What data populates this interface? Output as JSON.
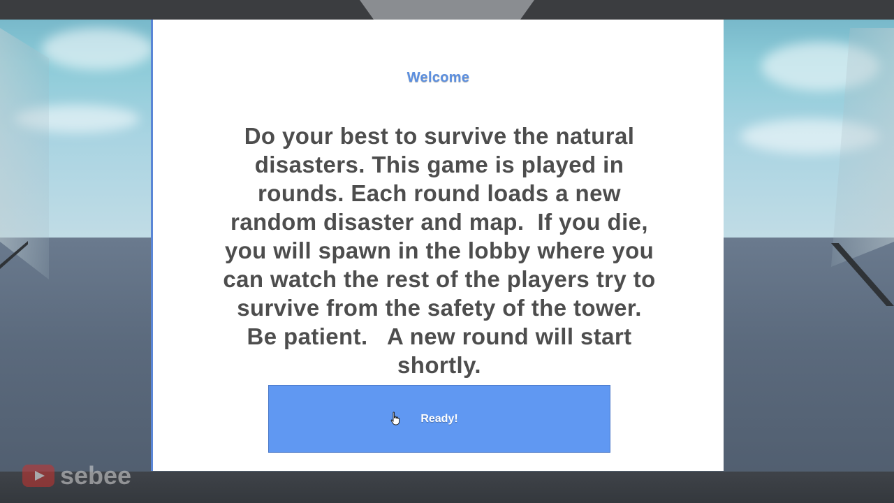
{
  "dialog": {
    "title": "Welcome",
    "body": "Do your best to survive the natural disasters. This game is played in rounds. Each round loads a new random disaster and map.  If you die, you will spawn in the lobby where you can watch the rest of the players try to survive from the safety of the tower.   Be patient.   A new round will start shortly.",
    "button_label": "Ready!"
  },
  "watermark": {
    "icon": "youtube-logo-icon",
    "text": "sebee"
  },
  "colors": {
    "title": "#5b8fe0",
    "button": "#6098f2",
    "body_text": "#4d4d4d",
    "dialog_bg": "#ffffff"
  }
}
